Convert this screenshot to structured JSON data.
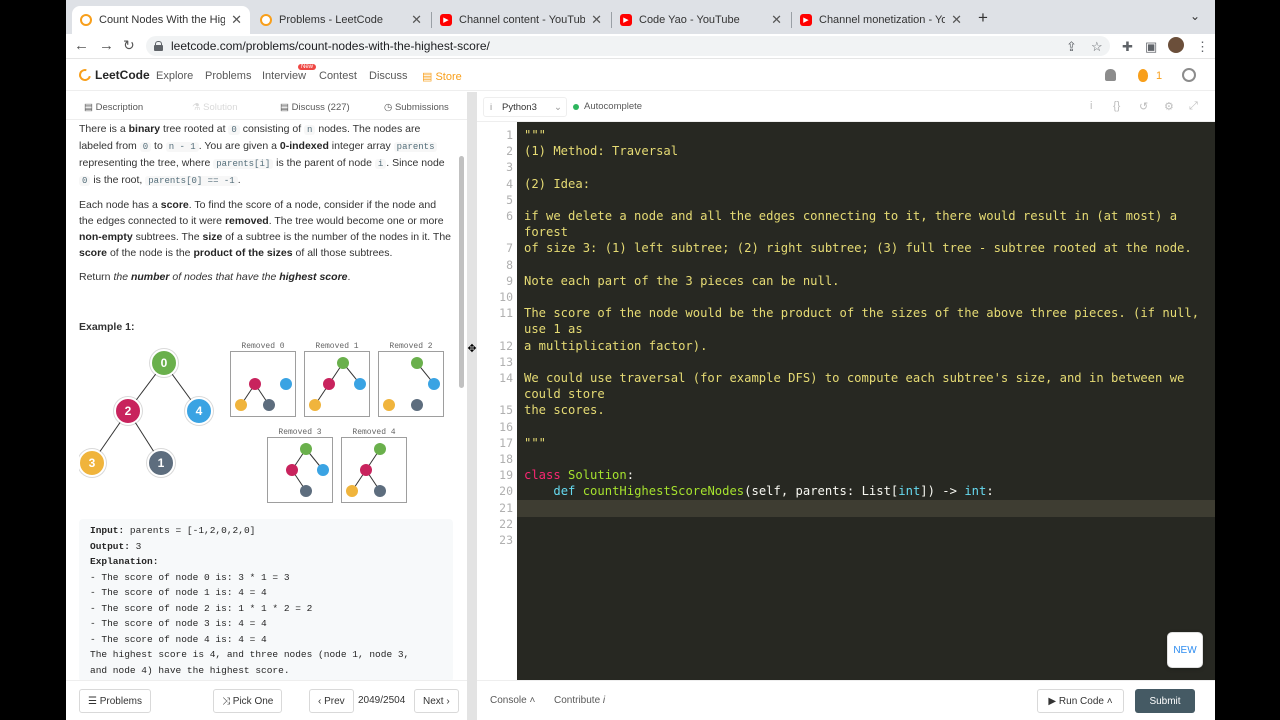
{
  "browser": {
    "tabs": [
      {
        "title": "Count Nodes With the Highest",
        "icon": "leetcode-icon",
        "active": true
      },
      {
        "title": "Problems - LeetCode",
        "icon": "leetcode-icon",
        "active": false
      },
      {
        "title": "Channel content - YouTube Stu",
        "icon": "youtube-icon",
        "active": false
      },
      {
        "title": "Code Yao - YouTube",
        "icon": "youtube-icon",
        "active": false
      },
      {
        "title": "Channel monetization - YouTub",
        "icon": "youtube-icon",
        "active": false
      }
    ],
    "url": "leetcode.com/problems/count-nodes-with-the-highest-score/"
  },
  "site_nav": {
    "logo": "LeetCode",
    "items": [
      "Explore",
      "Problems",
      "Interview",
      "Contest",
      "Discuss"
    ],
    "new_badge": "New",
    "store": "Store",
    "streak": "1"
  },
  "left_tabs": {
    "description": "Description",
    "solution": "Solution",
    "discuss": "Discuss (227)",
    "submissions": "Submissions"
  },
  "problem": {
    "p1": {
      "a": "There is a ",
      "b": "binary",
      "c": " tree rooted at ",
      "code1": "0",
      "d": " consisting of ",
      "code2": "n",
      "e": " nodes. The nodes are labeled from ",
      "code3": "0",
      "f": " to ",
      "code4": "n - 1",
      "g": ". You are given a ",
      "h": "0-indexed",
      "i": " integer array ",
      "code5": "parents",
      "j": " representing the tree, where ",
      "code6": "parents[i]",
      "k": " is the parent of node ",
      "code7": "i",
      "l": ". Since node ",
      "code8": "0",
      "m": " is the root, ",
      "code9": "parents[0] == -1",
      "n": "."
    },
    "p2": {
      "a": "Each node has a ",
      "b": "score",
      "c": ". To find the score of a node, consider if the node and the edges connected to it were ",
      "d": "removed",
      "e": ". The tree would become one or more ",
      "f": "non-empty",
      "g": " subtrees. The ",
      "h": "size",
      "i": " of a subtree is the number of the nodes in it. The ",
      "j": "score",
      "k": " of the node is the ",
      "l": "product of the sizes",
      "m": " of all those subtrees."
    },
    "p3": {
      "a": "Return ",
      "b": "the ",
      "c": "number",
      "d": " of nodes that have the ",
      "e": "highest score",
      "f": "."
    },
    "example_heading": "Example 1:",
    "tree_nodes": [
      "0",
      "2",
      "4",
      "3",
      "1"
    ],
    "removed_labels": [
      "Removed 0",
      "Removed 1",
      "Removed 2",
      "Removed 3",
      "Removed 4"
    ],
    "example_block": {
      "input_label": "Input:",
      "input": " parents = [-1,2,0,2,0]",
      "output_label": "Output:",
      "output": " 3",
      "explanation_label": "Explanation:",
      "lines": [
        "- The score of node 0 is: 3 * 1 = 3",
        "- The score of node 1 is: 4 = 4",
        "- The score of node 2 is: 1 * 1 * 2 = 2",
        "- The score of node 3 is: 4 = 4",
        "- The score of node 4 is: 4 = 4",
        "The highest score is 4, and three nodes (node 1, node 3,",
        "and node 4) have the highest score."
      ]
    }
  },
  "left_footer": {
    "problems": "Problems",
    "pick_one": "Pick One",
    "prev": "Prev",
    "page": "2049/2504",
    "next": "Next"
  },
  "editor": {
    "language": "Python3",
    "autocomplete": "Autocomplete",
    "line_numbers": [
      "1",
      "2",
      "3",
      "4",
      "5",
      "6",
      "",
      "7",
      "8",
      "9",
      "10",
      "11",
      "",
      "12",
      "13",
      "14",
      "",
      "15",
      "16",
      "17",
      "18",
      "19",
      "20",
      "21",
      "22",
      "23"
    ],
    "lines": [
      "\"\"\"",
      "(1) Method: Traversal",
      "",
      "(2) Idea:",
      "",
      "if we delete a node and all the edges connecting to it, there would result in (at most) a",
      "forest",
      "of size 3: (1) left subtree; (2) right subtree; (3) full tree - subtree rooted at the node.",
      "",
      "Note each part of the 3 pieces can be null.",
      "",
      "The score of the node would be the product of the sizes of the above three pieces. (if null,",
      "use 1 as",
      "a multiplication factor).",
      "",
      "We could use traversal (for example DFS) to compute each subtree's size, and in between we",
      "could store",
      "the scores.",
      "",
      "\"\"\"",
      "",
      "",
      "",
      "",
      "",
      ""
    ],
    "class_kw": "class",
    "class_name": "Solution",
    "def_kw": "def",
    "func_name": "countHighestScoreNodes",
    "sig_a": "(self, parents: ",
    "sig_list": "List",
    "sig_b": "[",
    "sig_int": "int",
    "sig_c": "]) -> ",
    "sig_ret": "int",
    "sig_d": ":",
    "new_button": "NEW"
  },
  "right_footer": {
    "console": "Console",
    "contribute": "Contribute",
    "run": "Run Code",
    "submit": "Submit"
  },
  "colors": {
    "accent": "#f89f1b",
    "node_green": "#6ab04c",
    "node_pink": "#c8235d",
    "node_blue": "#3aa3e3",
    "node_yellow": "#f0b43c",
    "node_gray": "#5d6d7e"
  }
}
